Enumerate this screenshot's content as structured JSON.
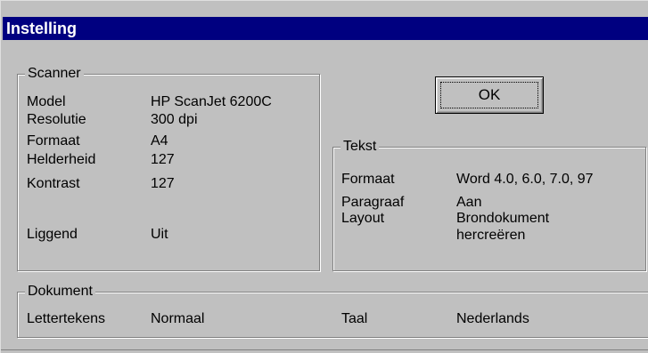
{
  "window": {
    "title": "Instelling"
  },
  "ok_button": {
    "label": "OK"
  },
  "scanner": {
    "legend": "Scanner",
    "rows": [
      {
        "label": "Model",
        "value": "HP ScanJet 6200C"
      },
      {
        "label": "Resolutie",
        "value": "300 dpi"
      },
      {
        "label": "Formaat",
        "value": "A4"
      },
      {
        "label": "Helderheid",
        "value": "127"
      },
      {
        "label": "Kontrast",
        "value": "127"
      },
      {
        "label": "Liggend",
        "value": "Uit"
      }
    ]
  },
  "tekst": {
    "legend": "Tekst",
    "rows": [
      {
        "label": "Formaat",
        "value": "Word 4.0, 6.0, 7.0, 97"
      },
      {
        "label": "Paragraaf",
        "value": "Aan"
      },
      {
        "label": "Layout",
        "value": "Brondokument",
        "value2": "hercreëren"
      }
    ]
  },
  "dokument": {
    "legend": "Dokument",
    "lettertekens_label": "Lettertekens",
    "lettertekens_value": "Normaal",
    "taal_label": "Taal",
    "taal_value": "Nederlands"
  }
}
